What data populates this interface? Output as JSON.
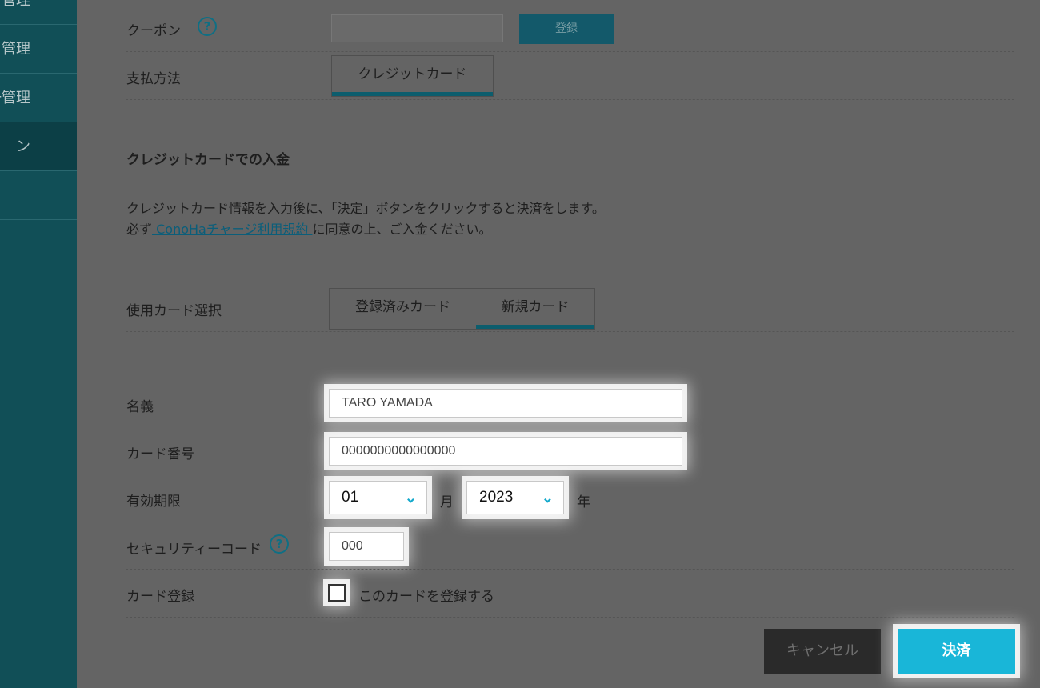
{
  "sidebar": {
    "items": [
      {
        "label": "管理",
        "active": false
      },
      {
        "label": "管理",
        "active": false
      },
      {
        "label": "一管理",
        "active": false
      },
      {
        "label": "ン",
        "active": true
      },
      {
        "label": "",
        "active": false
      }
    ]
  },
  "coupon": {
    "label": "クーポン",
    "help_icon": "question-circle-icon",
    "input_value": "",
    "register_button": "登録"
  },
  "payment_method": {
    "label": "支払方法",
    "tab": "クレジットカード"
  },
  "section": {
    "title": "クレジットカードでの入金",
    "desc_line1": "クレジットカード情報を入力後に、「決定」ボタンをクリックすると決済をします。",
    "desc_line2_prefix": "必ず",
    "desc_link": " ConoHaチャージ利用規約 ",
    "desc_line2_suffix": "に同意の上、ご入金ください。"
  },
  "card_select": {
    "label": "使用カード選択",
    "tabs": [
      "登録済みカード",
      "新規カード"
    ],
    "active_tab": "新規カード"
  },
  "form": {
    "name_label": "名義",
    "name_value": "TARO YAMADA",
    "number_label": "カード番号",
    "number_value": "0000000000000000",
    "expiry_label": "有効期限",
    "month_value": "01",
    "month_unit": "月",
    "year_value": "2023",
    "year_unit": "年",
    "cvc_label": "セキュリティーコード",
    "cvc_value": "000",
    "register_label": "カード登録",
    "register_checkbox_text": "このカードを登録する",
    "register_checked": false
  },
  "actions": {
    "cancel": "キャンセル",
    "submit": "決済"
  },
  "colors": {
    "accent": "#19b6d8",
    "sidebar": "#114f57",
    "overlay": "#646464"
  }
}
